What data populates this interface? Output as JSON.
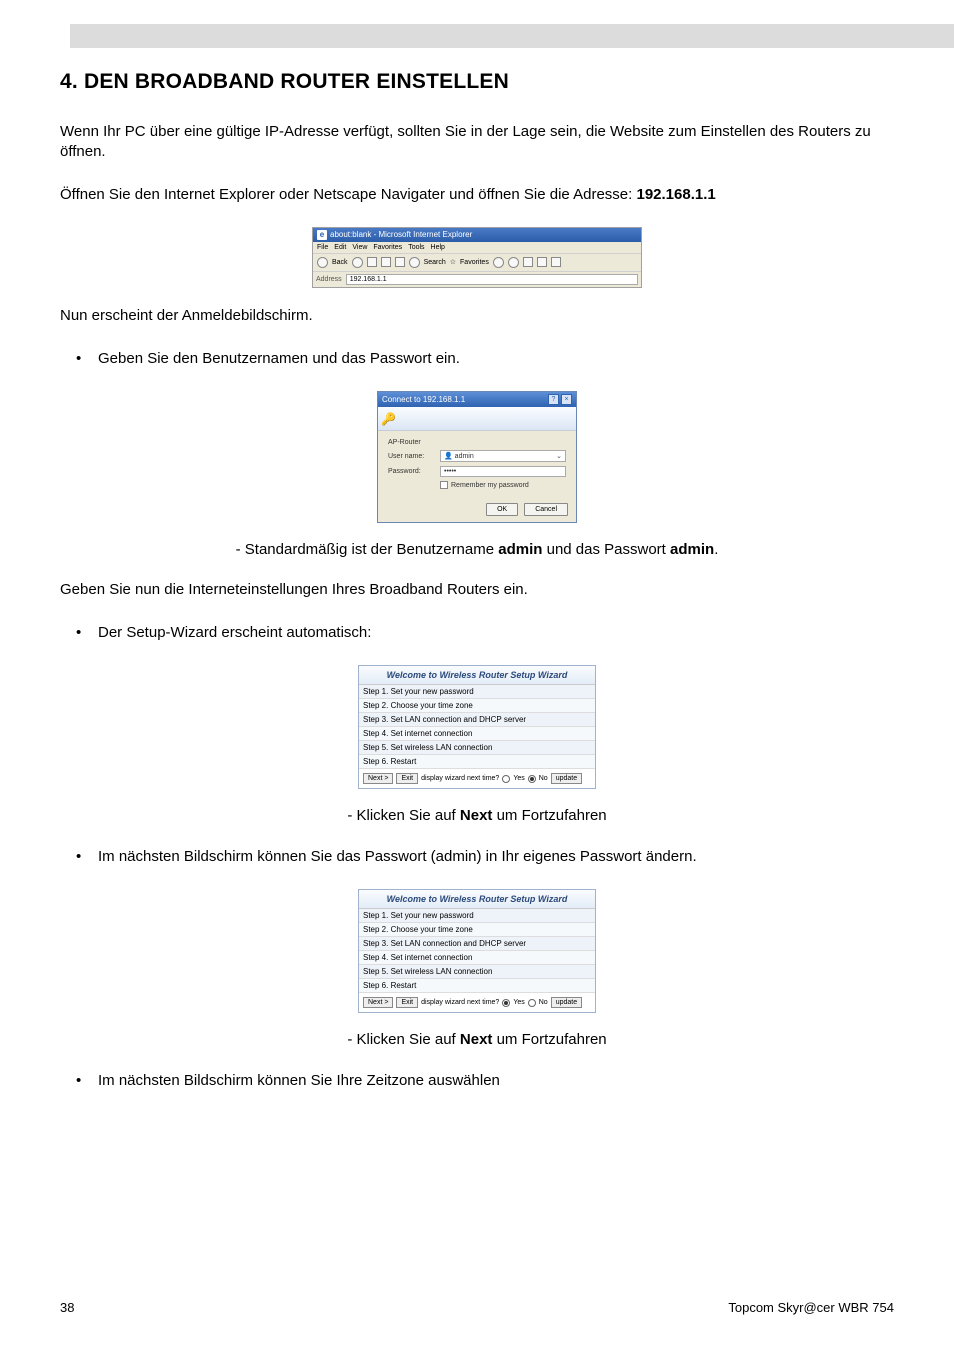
{
  "greyBar": true,
  "heading": "4.  DEN BROADBAND ROUTER EINSTELLEN",
  "para1_a": "Wenn Ihr PC über eine gültige IP-Adresse verfügt, sollten Sie in der Lage sein, die Website zum Einstellen des Routers zu öffnen.",
  "para2_a": "Öffnen Sie den Internet Explorer oder Netscape Navigater und öffnen Sie die Adresse: ",
  "para2_b": "192.168.1.1",
  "ie": {
    "title": "about:blank - Microsoft Internet Explorer",
    "menus": [
      "File",
      "Edit",
      "View",
      "Favorites",
      "Tools",
      "Help"
    ],
    "tool_back": "Back",
    "tool_search": "Search",
    "tool_fav": "Favorites",
    "addr_label": "Address",
    "addr_value": "192.168.1.1"
  },
  "para3": "Nun erscheint der Anmeldebildschirm.",
  "bullet1": "Geben Sie den Benutzernamen und das Passwort ein.",
  "login": {
    "title": "Connect to 192.168.1.1",
    "realm": "AP-Router",
    "user_label": "User name:",
    "user_value": "admin",
    "pass_label": "Password:",
    "pass_value": "•••••",
    "remember": "Remember my password",
    "ok": "OK",
    "cancel": "Cancel"
  },
  "note1_a": "- Standardmäßig ist der Benutzername ",
  "note1_b": "admin",
  "note1_c": " und das Passwort ",
  "note1_d": "admin",
  "note1_e": ".",
  "para4": "Geben Sie nun die Interneteinstellungen Ihres Broadband Routers ein.",
  "bullet2": "Der Setup-Wizard erscheint automatisch:",
  "wizard": {
    "title": "Welcome to Wireless Router Setup Wizard",
    "steps": [
      "Step 1. Set your new password",
      "Step 2. Choose your time zone",
      "Step 3. Set LAN connection and DHCP server",
      "Step 4. Set internet connection",
      "Step 5. Set wireless LAN connection",
      "Step 6. Restart"
    ],
    "next": "Next >",
    "exit": "Exit",
    "prompt": "display wizard next time?",
    "yes": "Yes",
    "no": "No",
    "update": "update"
  },
  "note2_a": "- Klicken Sie auf ",
  "note2_b": "Next",
  "note2_c": " um Fortzufahren",
  "bullet3": "Im nächsten Bildschirm können Sie das Passwort (admin) in Ihr eigenes Passwort ändern.",
  "note3_a": "- Klicken Sie auf ",
  "note3_b": "Next",
  "note3_c": " um Fortzufahren",
  "bullet4": "Im nächsten Bildschirm können Sie Ihre Zeitzone auswählen",
  "footer_left": "38",
  "footer_right": "Topcom Skyr@cer WBR 754"
}
